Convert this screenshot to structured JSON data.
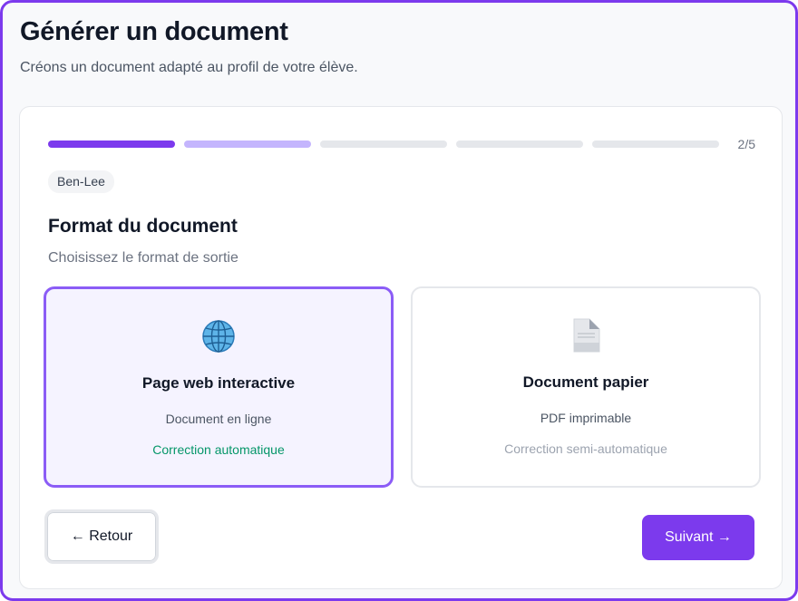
{
  "header": {
    "title": "Générer un document",
    "subtitle": "Créons un document adapté au profil de votre élève."
  },
  "wizard": {
    "current_step": 2,
    "total_steps": 5,
    "step_label": "2/5",
    "student_name": "Ben-Lee",
    "section_title": "Format du document",
    "section_subtitle": "Choisissez le format de sortie",
    "options": [
      {
        "icon": "globe-icon",
        "title": "Page web interactive",
        "description": "Document en ligne",
        "correction": "Correction automatique",
        "selected": true
      },
      {
        "icon": "document-icon",
        "title": "Document papier",
        "description": "PDF imprimable",
        "correction": "Correction semi-automatique",
        "selected": false
      }
    ],
    "back_label": "← Retour",
    "next_label": "Suivant →"
  },
  "colors": {
    "accent": "#7c3aed",
    "accent_light": "#c4b5fd",
    "selected_bg": "#f5f3ff",
    "auto_correction": "#059669"
  }
}
